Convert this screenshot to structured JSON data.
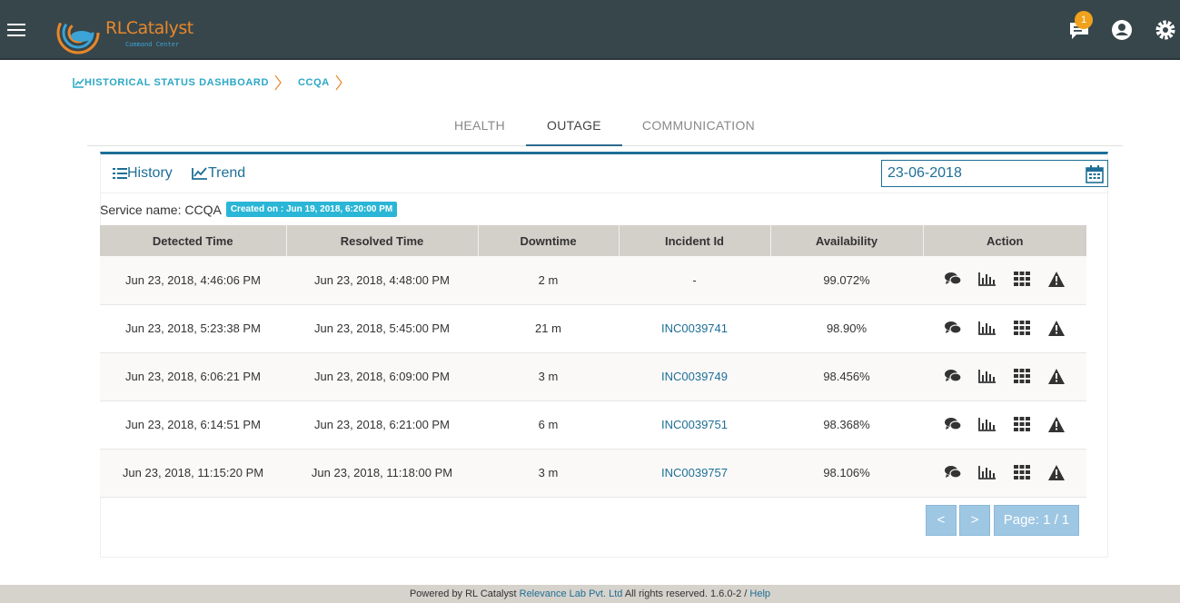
{
  "app": {
    "logo_text_main": "RLCatalyst",
    "logo_text_sub": "Command Center",
    "notification_count": "1"
  },
  "icons": {
    "menu": "hamburger-menu-icon",
    "notifications": "chat-bubble-icon",
    "account": "account-circle-icon",
    "settings": "gear-icon",
    "calendar": "calendar-icon",
    "history": "list-icon",
    "trend": "line-chart-icon",
    "row_actions": [
      "comments-icon",
      "bar-chart-icon",
      "grid-icon",
      "warning-icon"
    ]
  },
  "breadcrumb": {
    "items": [
      "HISTORICAL STATUS DASHBOARD",
      "CCQA"
    ]
  },
  "tabs": [
    "HEALTH",
    "OUTAGE",
    "COMMUNICATION"
  ],
  "active_tab": "OUTAGE",
  "view_toggle": {
    "history_label": "History",
    "trend_label": "Trend"
  },
  "date_filter": {
    "value": "23-06-2018"
  },
  "service": {
    "label": "Service name: CCQA",
    "created_badge": "Created on : Jun 19, 2018, 6:20:00 PM"
  },
  "table": {
    "columns": [
      "Detected Time",
      "Resolved Time",
      "Downtime",
      "Incident Id",
      "Availability",
      "Action"
    ],
    "rows": [
      {
        "detected": "Jun 23, 2018, 4:46:06 PM",
        "resolved": "Jun 23, 2018, 4:48:00 PM",
        "downtime": "2 m",
        "incident": "-",
        "availability": "99.072%"
      },
      {
        "detected": "Jun 23, 2018, 5:23:38 PM",
        "resolved": "Jun 23, 2018, 5:45:00 PM",
        "downtime": "21 m",
        "incident": "INC0039741",
        "availability": "98.90%"
      },
      {
        "detected": "Jun 23, 2018, 6:06:21 PM",
        "resolved": "Jun 23, 2018, 6:09:00 PM",
        "downtime": "3 m",
        "incident": "INC0039749",
        "availability": "98.456%"
      },
      {
        "detected": "Jun 23, 2018, 6:14:51 PM",
        "resolved": "Jun 23, 2018, 6:21:00 PM",
        "downtime": "6 m",
        "incident": "INC0039751",
        "availability": "98.368%"
      },
      {
        "detected": "Jun 23, 2018, 11:15:20 PM",
        "resolved": "Jun 23, 2018, 11:18:00 PM",
        "downtime": "3 m",
        "incident": "INC0039757",
        "availability": "98.106%"
      }
    ]
  },
  "pagination": {
    "prev_label": "<",
    "next_label": ">",
    "page_label": "Page: 1 / 1"
  },
  "footer": {
    "prefix": "Powered by RL Catalyst",
    "company": "Relevance Lab Pvt. Ltd",
    "rights": "All rights reserved. 1.6.0-2 /",
    "help": "Help"
  },
  "colors": {
    "topbar": "#37464b",
    "accent": "#1e6f96",
    "breadcrumb": "#2aa7c6",
    "badge": "#2ab6d6",
    "notification_badge": "#f0a21c",
    "header_row": "#d3cfc9"
  }
}
